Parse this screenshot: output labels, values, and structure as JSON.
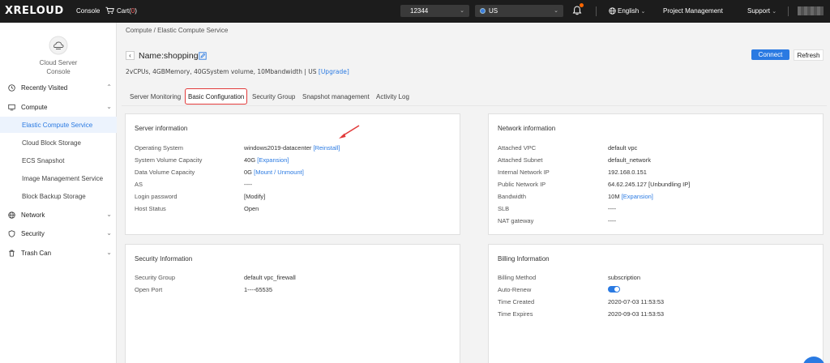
{
  "topbar": {
    "logo": "XRELOUD",
    "console": "Console",
    "cart_label": "Cart(",
    "cart_count": "0",
    "cart_close": ")",
    "account_select": "12344",
    "region_select": "US",
    "language": "English",
    "project_management": "Project Management",
    "support": "Support"
  },
  "sidebar": {
    "console_title_line1": "Cloud Server",
    "console_title_line2": "Console",
    "groups": [
      {
        "label": "Recently Visited",
        "icon": "clock-icon"
      },
      {
        "label": "Compute",
        "icon": "monitor-icon"
      },
      {
        "label": "Network",
        "icon": "globe-icon"
      },
      {
        "label": "Security",
        "icon": "shield-icon"
      },
      {
        "label": "Trash Can",
        "icon": "trash-icon"
      }
    ],
    "compute_items": [
      "Elastic Compute Service",
      "Cloud Block Storage",
      "ECS Snapshot",
      "Image Management Service",
      "Block Backup Storage"
    ]
  },
  "main": {
    "breadcrumb": "Compute / Elastic Compute Service",
    "name": "Name:shopping",
    "specs_text": "2vCPUs, 4GBMemory, 40GSystem volume, 10Mbandwidth | US ",
    "specs_link": "[Upgrade]",
    "connect": "Connect",
    "refresh": "Refresh",
    "tabs": [
      "Server Monitoring",
      "Basic Configuration",
      "Security Group",
      "Snapshot management",
      "Activity Log"
    ]
  },
  "server_info": {
    "title": "Server information",
    "os_label": "Operating System",
    "os_value": "windows2019-datacenter",
    "os_link": "[Reinstall]",
    "sysvol_label": "System Volume Capacity",
    "sysvol_value": "40G",
    "sysvol_link": "[Expansion]",
    "datavol_label": "Data Volume Capacity",
    "datavol_value": "0G",
    "datavol_link": "[Mount / Unmount]",
    "as_label": "AS",
    "as_value": "----",
    "pwd_label": "Login password",
    "pwd_link": "[Modify]",
    "status_label": "Host Status",
    "status_value": "Open"
  },
  "network_info": {
    "title": "Network information",
    "vpc_label": "Attached VPC",
    "vpc_value": "default vpc",
    "subnet_label": "Attached Subnet",
    "subnet_value": "default_network",
    "internal_label": "Internal Network IP",
    "internal_value": "192.168.0.151",
    "public_label": "Public Network IP",
    "public_value": "64.62.245.127 [Unbundling IP]",
    "bw_label": "Bandwidth",
    "bw_value": "10M",
    "bw_link": "[Expansion]",
    "slb_label": "SLB",
    "slb_value": "----",
    "nat_label": "NAT gateway",
    "nat_value": "----"
  },
  "security_info": {
    "title": "Security Information",
    "group_label": "Security Group",
    "group_value": "default vpc_firewall",
    "port_label": "Open Port",
    "port_value": "1----65535"
  },
  "billing_info": {
    "title": "Billing Information",
    "method_label": "Billing Method",
    "method_value": "subscription",
    "renew_label": "Auto-Renew",
    "created_label": "Time Created",
    "created_value": "2020-07-03 11:53:53",
    "expires_label": "Time Expires",
    "expires_value": "2020-09-03 11:53:53"
  },
  "colors": {
    "accent": "#2a7ae2",
    "highlight": "#e23b3b",
    "topbar": "#1c1c1c"
  }
}
